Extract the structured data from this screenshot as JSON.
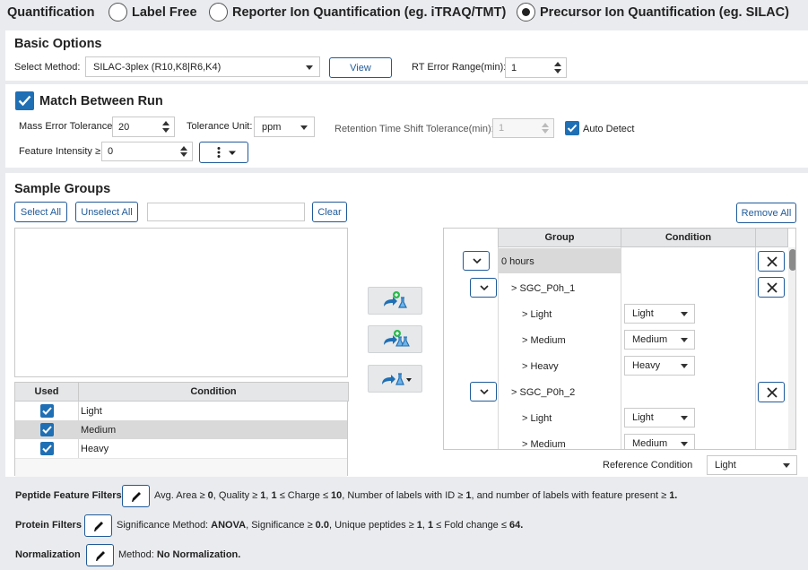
{
  "quantification": {
    "label": "Quantification",
    "options": [
      {
        "label": "Label Free",
        "selected": false
      },
      {
        "label": "Reporter Ion Quantification (eg. iTRAQ/TMT)",
        "selected": false
      },
      {
        "label": "Precursor Ion Quantification (eg. SILAC)",
        "selected": true
      }
    ]
  },
  "basic_options": {
    "title": "Basic Options",
    "method_label": "Select Method:",
    "method_value": "SILAC-3plex (R10,K8|R6,K4)",
    "view_label": "View",
    "rt_label": "RT Error Range(min):",
    "rt_value": "1"
  },
  "match_between_run": {
    "title": "Match Between Run",
    "checked": true,
    "mass_error_label": "Mass Error Tolerance:",
    "mass_error_value": "20",
    "tolerance_unit_label": "Tolerance Unit:",
    "tolerance_unit_value": "ppm",
    "rt_shift_label": "Retention Time Shift Tolerance(min):",
    "rt_shift_value": "1",
    "auto_detect_label": "Auto Detect",
    "auto_detect_checked": true,
    "feature_intensity_label": "Feature Intensity ≥",
    "feature_intensity_value": "0"
  },
  "sample_groups": {
    "title": "Sample Groups",
    "select_all": "Select All",
    "unselect_all": "Unselect All",
    "search_value": "",
    "clear": "Clear",
    "remove_all": "Remove All",
    "condition_table": {
      "headers": [
        "Used",
        "Condition"
      ],
      "rows": [
        {
          "used": true,
          "condition": "Light"
        },
        {
          "used": true,
          "condition": "Medium"
        },
        {
          "used": true,
          "condition": "Heavy"
        }
      ]
    },
    "group_table": {
      "headers": [
        "Group",
        "Condition"
      ],
      "rows": [
        {
          "text": "0 hours",
          "condition": ""
        },
        {
          "text": "> SGC_P0h_1",
          "condition": ""
        },
        {
          "text": "> Light",
          "condition": "Light"
        },
        {
          "text": "> Medium",
          "condition": "Medium"
        },
        {
          "text": "> Heavy",
          "condition": "Heavy"
        },
        {
          "text": "> SGC_P0h_2",
          "condition": ""
        },
        {
          "text": "> Light",
          "condition": "Light"
        },
        {
          "text": "> Medium",
          "condition": "Medium"
        }
      ]
    },
    "reference_condition_label": "Reference Condition",
    "reference_condition_value": "Light"
  },
  "filters": {
    "peptide": {
      "label": "Peptide Feature Filters",
      "parts": [
        {
          "t": "Avg. Area ≥ ",
          "b": false
        },
        {
          "t": "0",
          "b": true
        },
        {
          "t": ", Quality ≥ ",
          "b": false
        },
        {
          "t": "1",
          "b": true
        },
        {
          "t": ", ",
          "b": false
        },
        {
          "t": "1",
          "b": true
        },
        {
          "t": " ≤ Charge ≤ ",
          "b": false
        },
        {
          "t": "10",
          "b": true
        },
        {
          "t": ", Number of labels with ID ≥ ",
          "b": false
        },
        {
          "t": "1",
          "b": true
        },
        {
          "t": ", and number of labels with feature present ≥ ",
          "b": false
        },
        {
          "t": "1.",
          "b": true
        }
      ]
    },
    "protein": {
      "label": "Protein Filters",
      "parts": [
        {
          "t": "Significance Method: ",
          "b": false
        },
        {
          "t": "ANOVA",
          "b": true
        },
        {
          "t": ", Significance ≥ ",
          "b": false
        },
        {
          "t": "0.0",
          "b": true
        },
        {
          "t": ", Unique peptides ≥ ",
          "b": false
        },
        {
          "t": "1",
          "b": true
        },
        {
          "t": ", ",
          "b": false
        },
        {
          "t": "1",
          "b": true
        },
        {
          "t": " ≤ Fold change ≤ ",
          "b": false
        },
        {
          "t": "64.",
          "b": true
        }
      ]
    },
    "normalization": {
      "label": "Normalization",
      "parts": [
        {
          "t": "Method: ",
          "b": false
        },
        {
          "t": "No Normalization.",
          "b": true
        }
      ]
    }
  },
  "colors": {
    "accent": "#1f6fb4",
    "border_blue": "#1f5a99",
    "selected_row": "#d9d9d9",
    "green": "#2db84d"
  }
}
